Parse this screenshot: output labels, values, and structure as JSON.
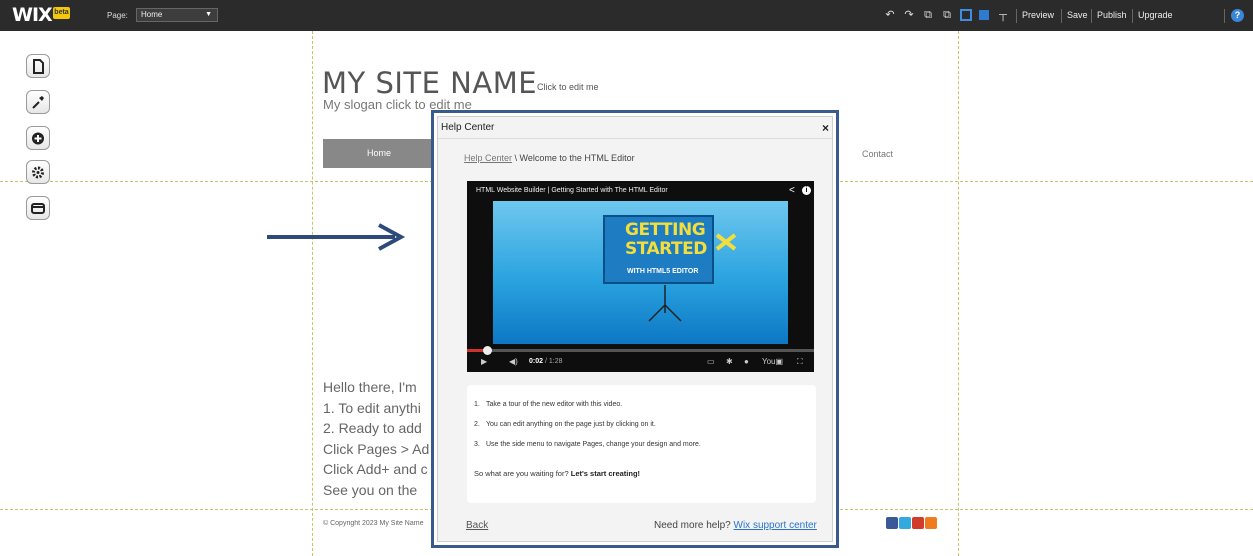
{
  "topbar": {
    "logo": "WIX",
    "beta": "beta",
    "page_label": "Page:",
    "page_value": "Home",
    "buttons": [
      "Preview",
      "Save",
      "Publish",
      "Upgrade"
    ],
    "help": "?"
  },
  "side_tools": [
    "pages-icon",
    "design-icon",
    "add-icon",
    "settings-icon",
    "app-market-icon"
  ],
  "site": {
    "name": "MY SITE NAME",
    "name_hint": "Click to edit me",
    "slogan": "My slogan click to edit me",
    "menu_home": "Home",
    "menu_contact": "Contact",
    "body_lines": [
      "Hello there, I'm",
      "1. To edit anythi",
      "2. Ready to add",
      "Click Pages > Ad",
      "Click Add+ and c",
      "See you on the"
    ],
    "copyright": "© Copyright 2023 My Site Name"
  },
  "dialog": {
    "title": "Help Center",
    "close": "×",
    "breadcrumb_link": "Help Center",
    "breadcrumb_rest": " \\ Welcome to the HTML Editor",
    "video": {
      "title": "HTML Website Builder | Getting Started with The HTML Editor",
      "board_line1": "GETTING",
      "board_line2": "STARTED",
      "board_line3": "WITH HTML5 EDITOR",
      "time_current": "0:02",
      "time_total": " / 1:28",
      "progress": 0.02
    },
    "steps": [
      {
        "num": "1.",
        "text": "Take a tour of the new editor with this video."
      },
      {
        "num": "2.",
        "text": "You can edit anything on the page just by clicking on it."
      },
      {
        "num": "3.",
        "text": "Use the side menu to navigate Pages, change your design and more."
      }
    ],
    "cta_prefix": "So what are you waiting for? ",
    "cta_bold": "Let's start creating!",
    "back": "Back",
    "more_help": "Need more help? ",
    "support_link": "Wix support center"
  },
  "colors": {
    "topbar": "#2b2b2b",
    "dialog_frame": "#3a5a8c",
    "link": "#2b74c8",
    "accent_yellow": "#f2c80d"
  }
}
